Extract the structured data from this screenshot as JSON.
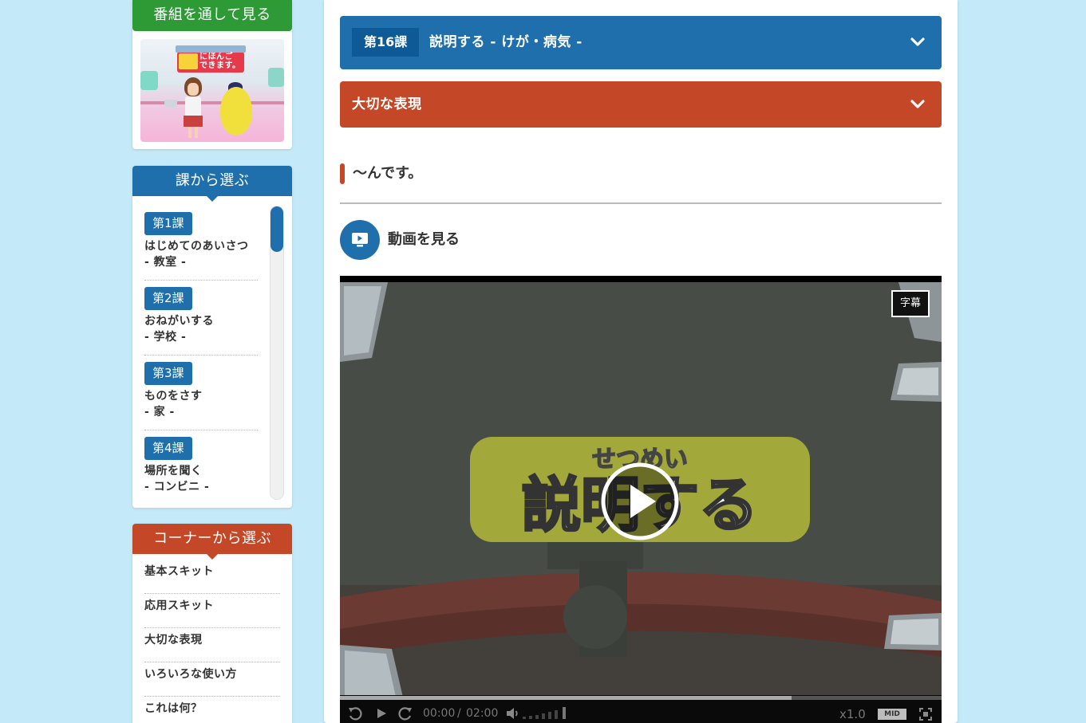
{
  "sidebar": {
    "program": {
      "heading": "番組を通して見る",
      "thumbnail_logo_text": "にほんご\nできます。"
    },
    "lessons": {
      "heading": "課から選ぶ",
      "items": [
        {
          "number": "第1課",
          "title": "はじめてのあいさつ",
          "subtitle": "- 教室 -"
        },
        {
          "number": "第2課",
          "title": "おねがいする",
          "subtitle": "- 学校 -"
        },
        {
          "number": "第3課",
          "title": "ものをさす",
          "subtitle": "- 家 -"
        },
        {
          "number": "第4課",
          "title": "場所を聞く",
          "subtitle": "- コンビニ -"
        }
      ]
    },
    "corners": {
      "heading": "コーナーから選ぶ",
      "items": [
        "基本スキット",
        "応用スキット",
        "大切な表現",
        "いろいろな使い方",
        "これは何？"
      ]
    }
  },
  "main": {
    "lesson_bar": {
      "tag": "第16課",
      "title": "説明する - けが・病気 -"
    },
    "expression_bar": {
      "title": "大切な表現"
    },
    "phrase": "〜んです。",
    "watch_video_label": "動画を見る",
    "video": {
      "subtitle_button": "字幕",
      "title_card_ruby": "せつめい",
      "title_card_text": "説明する",
      "current_time": "00:00",
      "time_separator": "/",
      "duration": "02:00",
      "progress_played": 0,
      "progress_buffered": 0.75,
      "volume_level": 1.0,
      "speed": "x1.0",
      "quality": "MID"
    }
  },
  "colors": {
    "background": "#c4e9f8",
    "blue": "#1e6fab",
    "red": "#c44727",
    "green": "#2e9a35"
  }
}
